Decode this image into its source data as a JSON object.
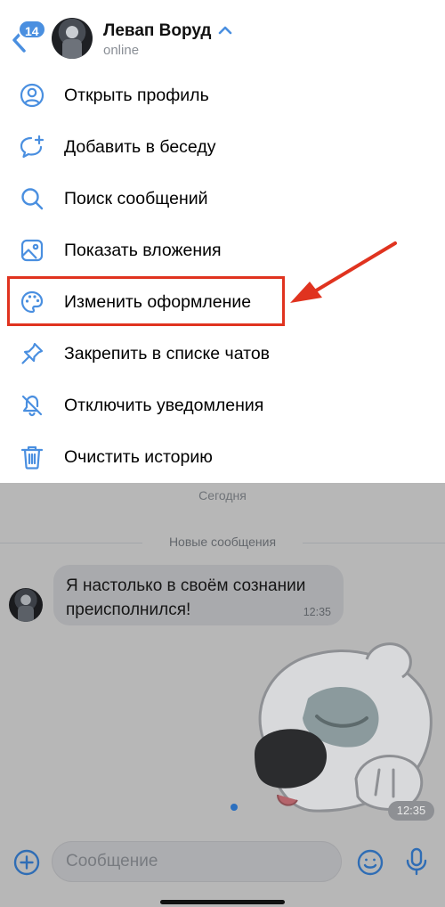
{
  "header": {
    "unread_count": "14",
    "contact_name": "Левап Воруд",
    "contact_status": "online"
  },
  "menu": {
    "items": [
      {
        "label": "Открыть профиль",
        "icon": "user-circle-icon"
      },
      {
        "label": "Добавить в беседу",
        "icon": "chat-add-icon"
      },
      {
        "label": "Поиск сообщений",
        "icon": "search-icon"
      },
      {
        "label": "Показать вложения",
        "icon": "image-icon"
      },
      {
        "label": "Изменить оформление",
        "icon": "palette-icon"
      },
      {
        "label": "Закрепить в списке чатов",
        "icon": "pin-icon"
      },
      {
        "label": "Отключить уведомления",
        "icon": "bell-off-icon"
      },
      {
        "label": "Очистить историю",
        "icon": "trash-icon"
      }
    ],
    "highlighted_item": "Изменить оформление"
  },
  "chat": {
    "date_separator": "Сегодня",
    "new_messages_label": "Новые сообщения",
    "messages": [
      {
        "text": "Я настолько в своём сознании преисполнился!",
        "time": "12:35"
      },
      {
        "type": "sticker",
        "time": "12:35"
      }
    ]
  },
  "composer": {
    "placeholder": "Сообщение"
  },
  "colors": {
    "accent": "#4a8fe0",
    "highlight_frame": "#e0331f",
    "dim_background": "#b7b7b7"
  }
}
